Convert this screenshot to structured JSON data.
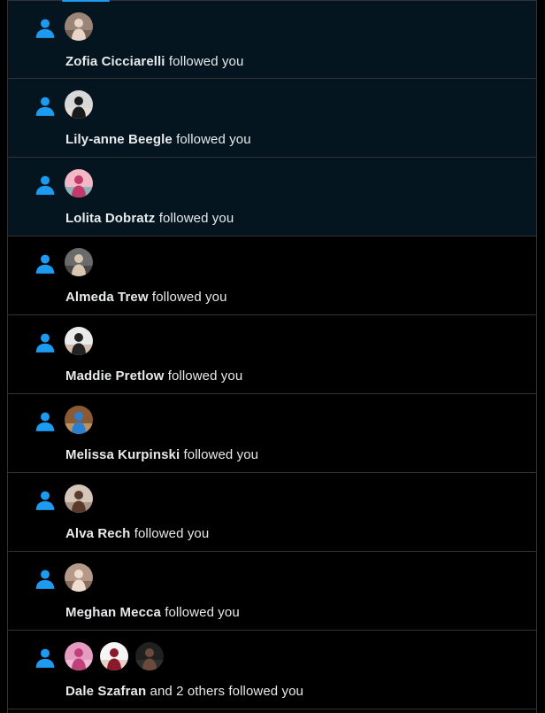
{
  "colors": {
    "background": "#000000",
    "unread_background": "#041520",
    "divider": "#2f3336",
    "accent": "#1d9bf0",
    "text": "#e7e9ea"
  },
  "icons": {
    "notification_type": "person-icon"
  },
  "notifications": [
    {
      "name": "Zofia Cicciarelli",
      "action": "followed you",
      "unread": true,
      "avatars": [
        {
          "bg": "#9a8578",
          "fg": "#e8d5c8",
          "accent": "#5a4438"
        }
      ]
    },
    {
      "name": "Lily-anne Beegle",
      "action": "followed you",
      "unread": true,
      "avatars": [
        {
          "bg": "#d8d8d8",
          "fg": "#1a1a1a",
          "accent": "#f0e0d0"
        }
      ]
    },
    {
      "name": "Lolita Dobratz",
      "action": "followed you",
      "unread": true,
      "avatars": [
        {
          "bg": "#f3b8c6",
          "fg": "#c23a6a",
          "accent": "#3bb0b0"
        }
      ]
    },
    {
      "name": "Almeda Trew",
      "action": "followed you",
      "unread": false,
      "avatars": [
        {
          "bg": "#6b6b6b",
          "fg": "#d8c6b0",
          "accent": "#2c2c2c"
        }
      ]
    },
    {
      "name": "Maddie Pretlow",
      "action": "followed you",
      "unread": false,
      "avatars": [
        {
          "bg": "#eaeaea",
          "fg": "#222222",
          "accent": "#c79a80"
        }
      ]
    },
    {
      "name": "Melissa Kurpinski",
      "action": "followed you",
      "unread": false,
      "avatars": [
        {
          "bg": "#8a5a34",
          "fg": "#2a7fd0",
          "accent": "#e3c18a"
        }
      ]
    },
    {
      "name": "Alva Rech",
      "action": "followed you",
      "unread": false,
      "avatars": [
        {
          "bg": "#d4c6b8",
          "fg": "#5a3a2a",
          "accent": "#8a7060"
        }
      ]
    },
    {
      "name": "Meghan Mecca",
      "action": "followed you",
      "unread": false,
      "avatars": [
        {
          "bg": "#b59a8a",
          "fg": "#f0ddd0",
          "accent": "#6a4a3a"
        }
      ]
    },
    {
      "name": "Dale Szafran",
      "action": "and 2 others followed you",
      "unread": false,
      "avatars": [
        {
          "bg": "#e59cc0",
          "fg": "#c0407a",
          "accent": "#f8d0e0"
        },
        {
          "bg": "#f5f5f5",
          "fg": "#8a1a2a",
          "accent": "#d8b0a0"
        },
        {
          "bg": "#202020",
          "fg": "#6a4a3a",
          "accent": "#3a3a3a"
        }
      ]
    }
  ]
}
